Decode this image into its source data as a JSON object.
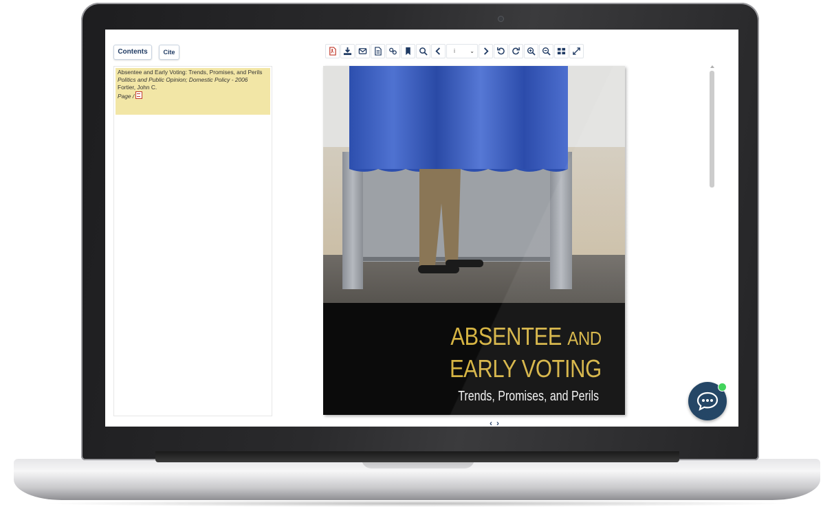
{
  "sidebar": {
    "tabs": [
      {
        "label": "Contents"
      },
      {
        "label": "Cite"
      }
    ],
    "toc_entry": {
      "title": "Absentee and Early Voting: Trends, Promises, and Perils",
      "series": "Politics and Public Opinion; Domestic Policy - 2006",
      "author": "Fortier, John C.",
      "page_label": "Page /"
    }
  },
  "toolbar": {
    "buttons": [
      "pdf-icon",
      "download-icon",
      "email-icon",
      "document-icon",
      "link-icon",
      "bookmark-icon",
      "search-icon",
      "previous-page-icon"
    ],
    "page_select_value": "i",
    "buttons_after": [
      "next-page-icon",
      "rotate-left-icon",
      "rotate-right-icon",
      "zoom-in-icon",
      "zoom-out-icon",
      "thumbnails-icon",
      "fullscreen-icon"
    ]
  },
  "book": {
    "title_line1_big": "ABSENTEE ",
    "title_line1_small": "AND",
    "title_line2": "EARLY VOTING",
    "subtitle": "Trends, Promises, and Perils"
  },
  "page_nav": {
    "prev": "‹",
    "next": "›"
  },
  "colors": {
    "accent": "#1f3a63",
    "toc_highlight": "#f2e6a6",
    "cover_title": "#d6b443",
    "chat": "#173b5c",
    "online": "#36d152"
  }
}
